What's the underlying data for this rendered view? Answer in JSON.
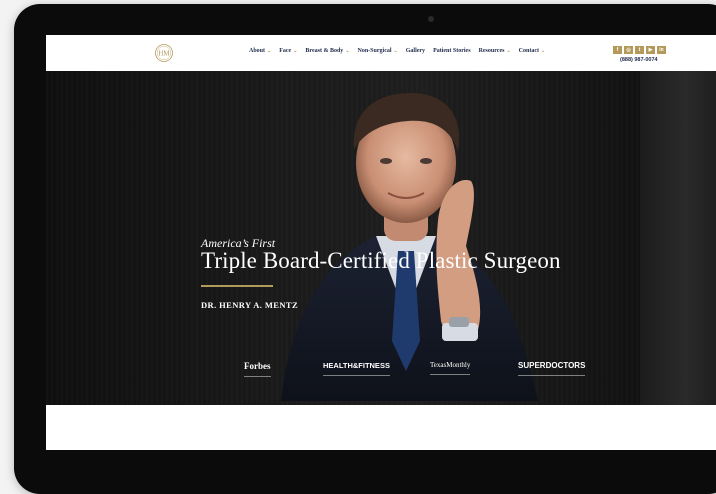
{
  "nav": {
    "logo_monogram": "HM",
    "items": [
      {
        "label": "About",
        "has_dropdown": true
      },
      {
        "label": "Face",
        "has_dropdown": true
      },
      {
        "label": "Breast & Body",
        "has_dropdown": true
      },
      {
        "label": "Non-Surgical",
        "has_dropdown": true
      },
      {
        "label": "Gallery",
        "has_dropdown": false
      },
      {
        "label": "Patient Stories",
        "has_dropdown": false
      },
      {
        "label": "Resources",
        "has_dropdown": true
      },
      {
        "label": "Contact",
        "has_dropdown": true
      }
    ],
    "social": [
      {
        "icon": "facebook-icon",
        "glyph": "f"
      },
      {
        "icon": "instagram-icon",
        "glyph": "◎"
      },
      {
        "icon": "twitter-icon",
        "glyph": "t"
      },
      {
        "icon": "youtube-icon",
        "glyph": "▶"
      },
      {
        "icon": "linkedin-icon",
        "glyph": "in"
      }
    ],
    "phone": "(888) 987-0074"
  },
  "hero": {
    "kicker": "America’s First",
    "headline": "Triple Board-Certified Plastic Surgeon",
    "doctor": "DR. HENRY A. MENTZ",
    "press": [
      "Forbes",
      "HEALTH&FITNESS",
      "TexasMonthly",
      "SUPERDOCTORS"
    ]
  },
  "colors": {
    "accent": "#b39a5a",
    "nav_text": "#1e2a4a",
    "hero_bg": "#161616"
  }
}
